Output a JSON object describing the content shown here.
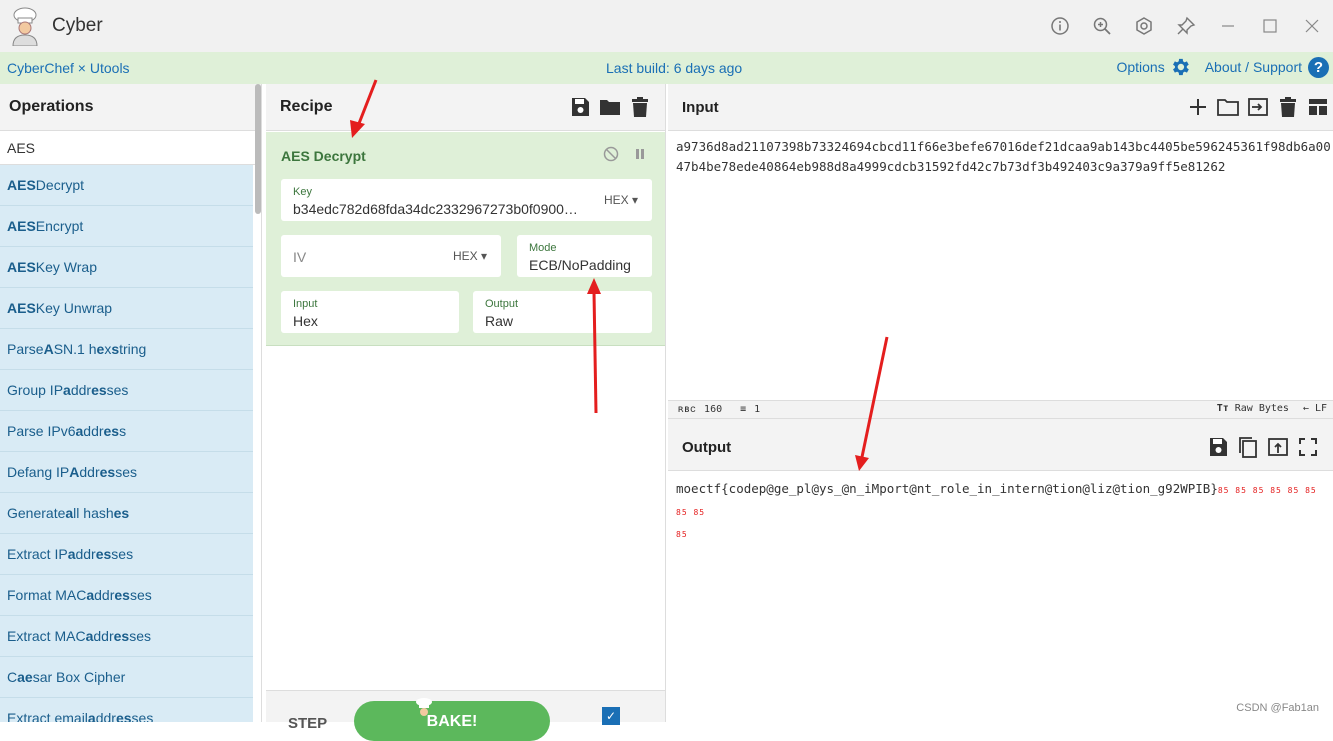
{
  "titlebar": {
    "app_name": "Cyber",
    "controls": [
      "info-icon",
      "zoom-icon",
      "settings-hex-icon",
      "pin-icon",
      "minimize-icon",
      "maximize-icon",
      "close-icon"
    ]
  },
  "topbar": {
    "brand": "CyberChef × Utools",
    "build": "Last build: 6 days ago",
    "options": "Options",
    "about": "About / Support"
  },
  "operations": {
    "title": "Operations",
    "search_value": "AES",
    "items": [
      {
        "pre": "",
        "bold": "AES",
        "post": " Decrypt"
      },
      {
        "pre": "",
        "bold": "AES",
        "post": " Encrypt"
      },
      {
        "pre": "",
        "bold": "AES",
        "post": " Key Wrap"
      },
      {
        "pre": "",
        "bold": "AES",
        "post": " Key Unwrap"
      },
      {
        "pre": "Parse ",
        "bold": "A",
        "post": "SN.1 h",
        "bold2": "e",
        "post2": "x ",
        "bold3": "s",
        "post3": "tring"
      },
      {
        "pre": "Group IP ",
        "bold": "a",
        "post": "ddr",
        "bold2": "es",
        "post2": "ses"
      },
      {
        "pre": "Parse IPv6 ",
        "bold": "a",
        "post": "ddr",
        "bold2": "es",
        "post2": "s"
      },
      {
        "pre": "Defang IP ",
        "bold": "A",
        "post": "ddr",
        "bold2": "es",
        "post2": "ses"
      },
      {
        "pre": "Generate ",
        "bold": "a",
        "post": "ll hash",
        "bold2": "es",
        "post2": ""
      },
      {
        "pre": "Extract IP ",
        "bold": "a",
        "post": "ddr",
        "bold2": "es",
        "post2": "ses"
      },
      {
        "pre": "Format MAC ",
        "bold": "a",
        "post": "ddr",
        "bold2": "es",
        "post2": "ses"
      },
      {
        "pre": "Extract MAC ",
        "bold": "a",
        "post": "ddr",
        "bold2": "es",
        "post2": "ses"
      },
      {
        "pre": "C",
        "bold": "ae",
        "post": "sar Box Cipher"
      },
      {
        "pre": "Extract email ",
        "bold": "a",
        "post": "ddr",
        "bold2": "es",
        "post2": "ses"
      }
    ]
  },
  "recipe": {
    "title": "Recipe",
    "operation": {
      "name": "AES Decrypt",
      "key_label": "Key",
      "key_value": "b34edc782d68fda34dc2332967273b0f0900…",
      "key_format": "HEX",
      "iv_placeholder": "IV",
      "iv_format": "HEX",
      "mode_label": "Mode",
      "mode_value": "ECB/NoPadding",
      "input_label": "Input",
      "input_value": "Hex",
      "output_label": "Output",
      "output_value": "Raw"
    },
    "step_label": "STEP",
    "bake_label": "BAKE!"
  },
  "input": {
    "title": "Input",
    "text": "a9736d8ad21107398b73324694cbcd11f66e3befe67016def21dcaa9ab143bc4405be596245361f98db6a0047b4be78ede40864eb988d8a4999cdcb31592fd42c7b73df3b492403c9a379a9ff5e81262",
    "status_length": "160",
    "status_lines": "1",
    "status_encoding": "Raw Bytes",
    "status_eol": "LF"
  },
  "output": {
    "title": "Output",
    "text": "moectf{codep@ge_pl@ys_@n_iMport@nt_role_in_intern@tion@liz@tion_g92WPIB}",
    "control_chars": "85 85 85 85 85 85 85 85",
    "control_chars_2": "85"
  },
  "watermark": "CSDN @Fab1an",
  "colors": {
    "accent": "#1a6fb5",
    "recipe_green": "#dff0d8",
    "ops_blue": "#d9ebf5",
    "bake_green": "#5cb85c",
    "arrow_red": "#e41e1e"
  }
}
